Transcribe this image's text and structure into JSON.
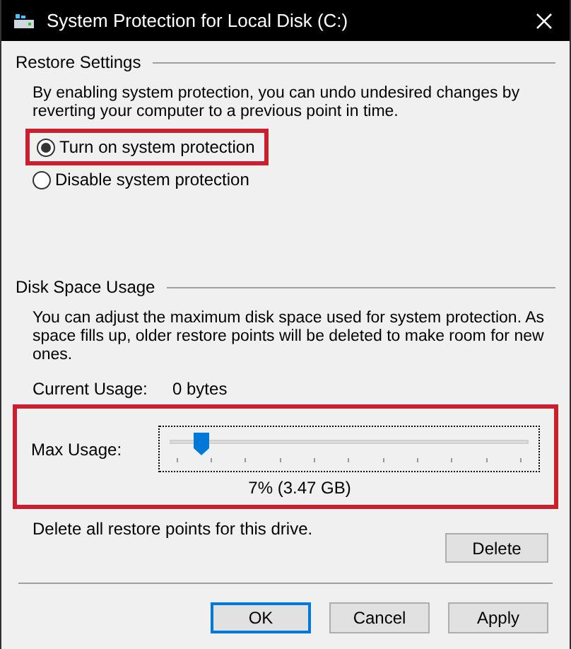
{
  "window": {
    "title": "System Protection for Local Disk (C:)"
  },
  "restore_settings": {
    "heading": "Restore Settings",
    "description": "By enabling system protection, you can undo undesired changes by reverting your computer to a previous point in time.",
    "options": [
      {
        "label": "Turn on system protection",
        "selected": true,
        "highlighted": true
      },
      {
        "label": "Disable system protection",
        "selected": false,
        "highlighted": false
      }
    ]
  },
  "disk_space_usage": {
    "heading": "Disk Space Usage",
    "description": "You can adjust the maximum disk space used for system protection. As space fills up, older restore points will be deleted to make room for new ones.",
    "current_usage_label": "Current Usage:",
    "current_usage_value": "0 bytes",
    "max_usage": {
      "label": "Max Usage:",
      "level": 0.07,
      "reading": "7% (3.47 GB)",
      "highlighted": true
    },
    "delete_text": "Delete all restore points for this drive.",
    "delete_button": "Delete"
  },
  "buttons": [
    {
      "label": "OK",
      "default": true
    },
    {
      "label": "Cancel",
      "default": false
    },
    {
      "label": "Apply",
      "default": false
    }
  ]
}
